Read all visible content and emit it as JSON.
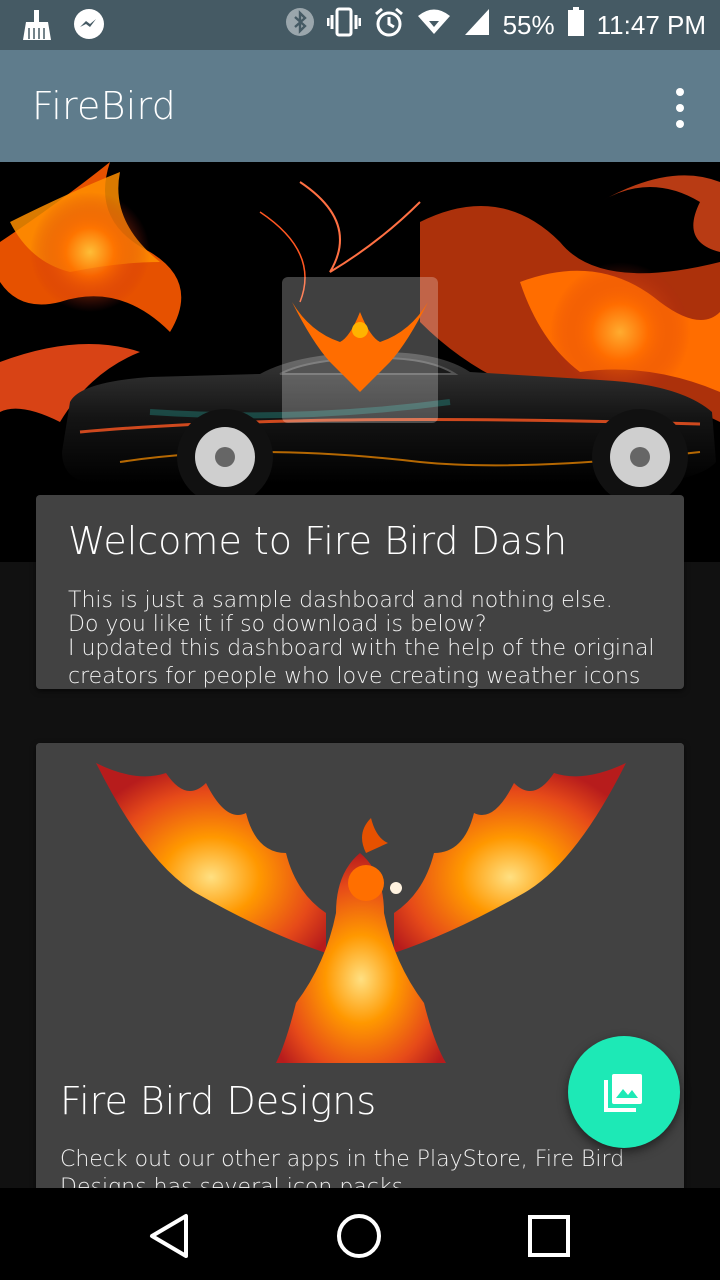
{
  "status_bar": {
    "left_icons": [
      "broom-icon",
      "messenger-icon"
    ],
    "right_icons": [
      "bluetooth-icon",
      "vibrate-icon",
      "alarm-icon",
      "wifi-icon",
      "signal-icon",
      "battery-icon"
    ],
    "battery": "55%",
    "time": "11:47 PM"
  },
  "app_bar": {
    "title": "FireBird",
    "menu_icon": "more-vert-icon"
  },
  "hero": {
    "image": "firebird-car-flames-image",
    "logo": "phoenix-logo"
  },
  "welcome_card": {
    "title": "Welcome to Fire Bird Dash",
    "lines": [
      "This is just a sample dashboard and nothing else.",
      "Do you like it if so download is below?",
      "I updated this dashboard with the help of the original",
      "creators for people who love creating weather icons"
    ]
  },
  "designs_card": {
    "image": "phoenix-image",
    "title": "Fire Bird Designs",
    "body": "Check out our other apps in the PlayStore, Fire Bird Designs has several icon packs"
  },
  "fab": {
    "icon": "photo-library-icon",
    "color": "#1de9b6"
  },
  "nav_bar": {
    "buttons": [
      "back-icon",
      "home-icon",
      "recents-icon"
    ]
  },
  "colors": {
    "status_bar": "#455a64",
    "app_bar": "#5f7c8c",
    "card": "#424242",
    "background": "#111111"
  }
}
